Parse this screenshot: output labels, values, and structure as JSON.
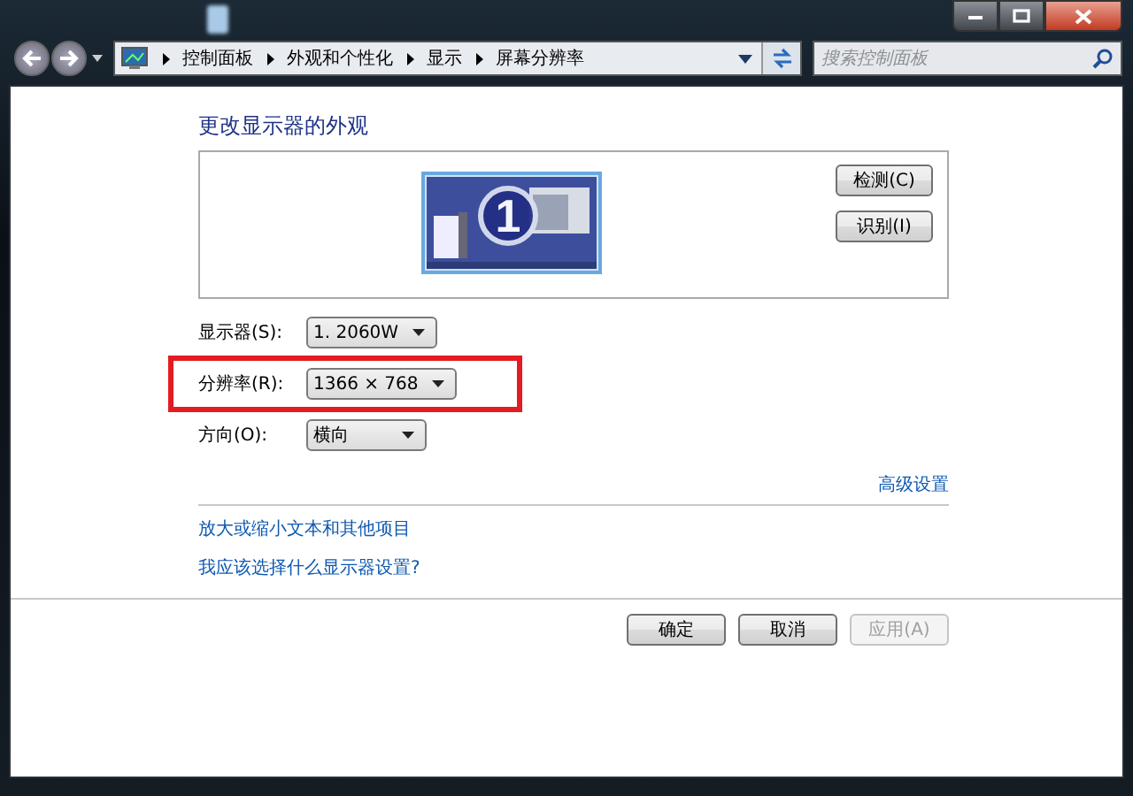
{
  "address_bar": {
    "breadcrumbs": [
      "控制面板",
      "外观和个性化",
      "显示",
      "屏幕分辨率"
    ]
  },
  "search": {
    "placeholder": "搜索控制面板"
  },
  "heading": "更改显示器的外观",
  "preview": {
    "monitor_number": "1",
    "buttons": [
      "检测(C)",
      "识别(I)"
    ]
  },
  "settings": [
    {
      "label": "显示器(S):",
      "value": "1. 2060W",
      "highlighted": false
    },
    {
      "label": "分辨率(R):",
      "value": "1366 × 768",
      "highlighted": true
    },
    {
      "label": "方向(O):",
      "value": "横向",
      "highlighted": false
    }
  ],
  "advanced_link": "高级设置",
  "links": [
    "放大或缩小文本和其他项目",
    "我应该选择什么显示器设置?"
  ],
  "buttons": [
    {
      "label": "确定",
      "disabled": false
    },
    {
      "label": "取消",
      "disabled": false
    },
    {
      "label": "应用(A)",
      "disabled": true
    }
  ]
}
